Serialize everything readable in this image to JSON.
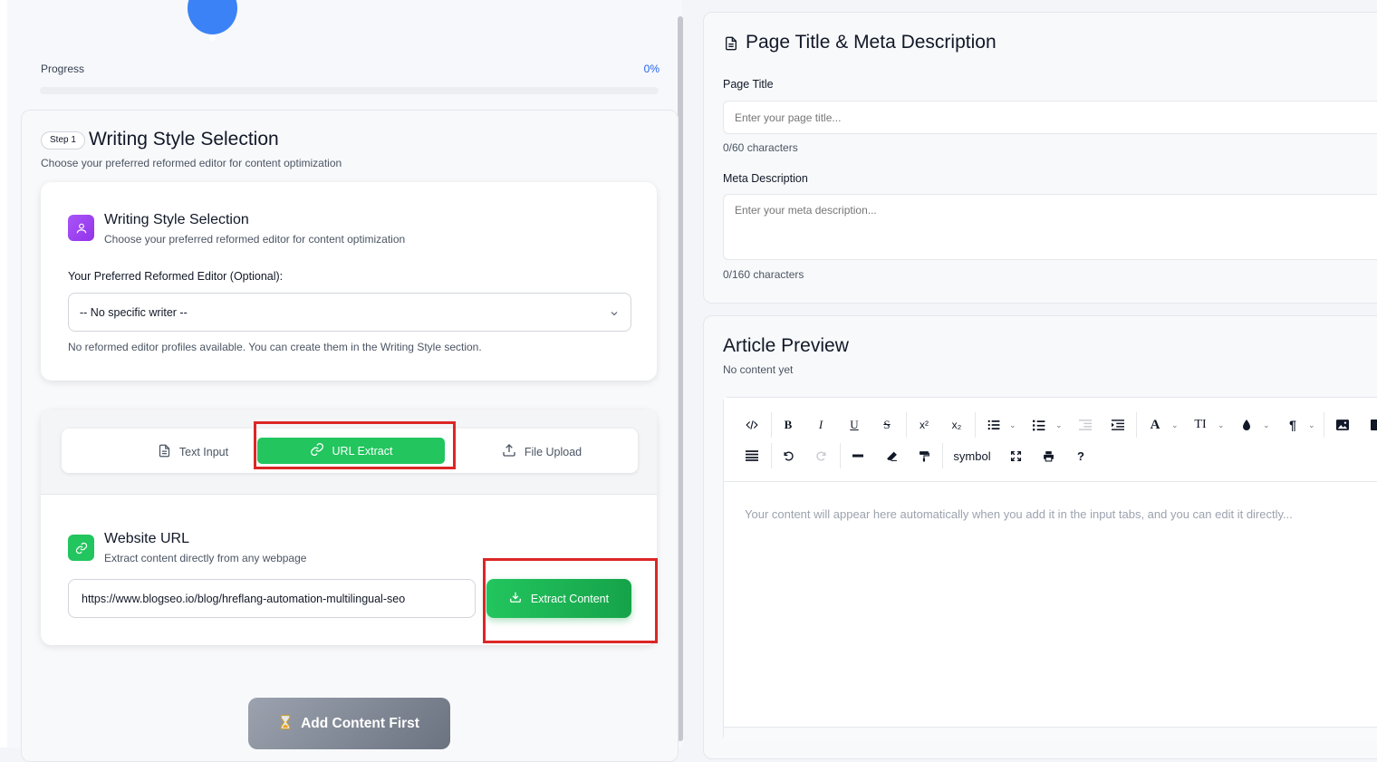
{
  "progress": {
    "label": "Progress",
    "percent_text": "0%",
    "value": 0
  },
  "step": {
    "badge": "Step 1",
    "title": "Writing Style Selection",
    "subtitle": "Choose your preferred reformed editor for content optimization"
  },
  "writing_style": {
    "title": "Writing Style Selection",
    "subtitle": "Choose your preferred reformed editor for content optimization",
    "editor_label": "Your Preferred Reformed Editor (Optional):",
    "selected_editor": "-- No specific writer --",
    "note": "No reformed editor profiles available. You can create them in the Writing Style section."
  },
  "input_tabs": {
    "items": [
      {
        "label": "Text Input",
        "icon": "document-icon"
      },
      {
        "label": "URL Extract",
        "icon": "link-icon",
        "active": true
      },
      {
        "label": "File Upload",
        "icon": "upload-icon"
      }
    ]
  },
  "website_url": {
    "title": "Website URL",
    "subtitle": "Extract content directly from any webpage",
    "url_value": "https://www.blogseo.io/blog/hreflang-automation-multilingual-seo",
    "extract_label": "Extract Content"
  },
  "add_button": {
    "label": "Add Content First",
    "icon": "hourglass-icon"
  },
  "meta": {
    "title": "Page Title & Meta Description",
    "page_title_label": "Page Title",
    "page_title_placeholder": "Enter your page title...",
    "page_title_count": "0/60 characters",
    "meta_label": "Meta Description",
    "meta_placeholder": "Enter your meta description...",
    "meta_count": "0/160 characters"
  },
  "article": {
    "title": "Article Preview",
    "subtitle": "No content yet",
    "placeholder": "Your content will appear here automatically when you add it in the input tabs, and you can edit it directly...",
    "toolbar": {
      "symbol_label": "symbol",
      "help_label": "?",
      "bold_label": "B",
      "italic_label": "I",
      "underline_label": "U",
      "strike_label": "S",
      "superscript_label": "x²",
      "subscript_label": "x₂",
      "font_color_label": "A",
      "font_size_label": "TI",
      "paragraph_label": "¶"
    }
  },
  "colors": {
    "primary_blue": "#2563eb",
    "accent_green": "#22c55e",
    "highlight_red": "#dc2626",
    "purple": "#a855f7"
  }
}
